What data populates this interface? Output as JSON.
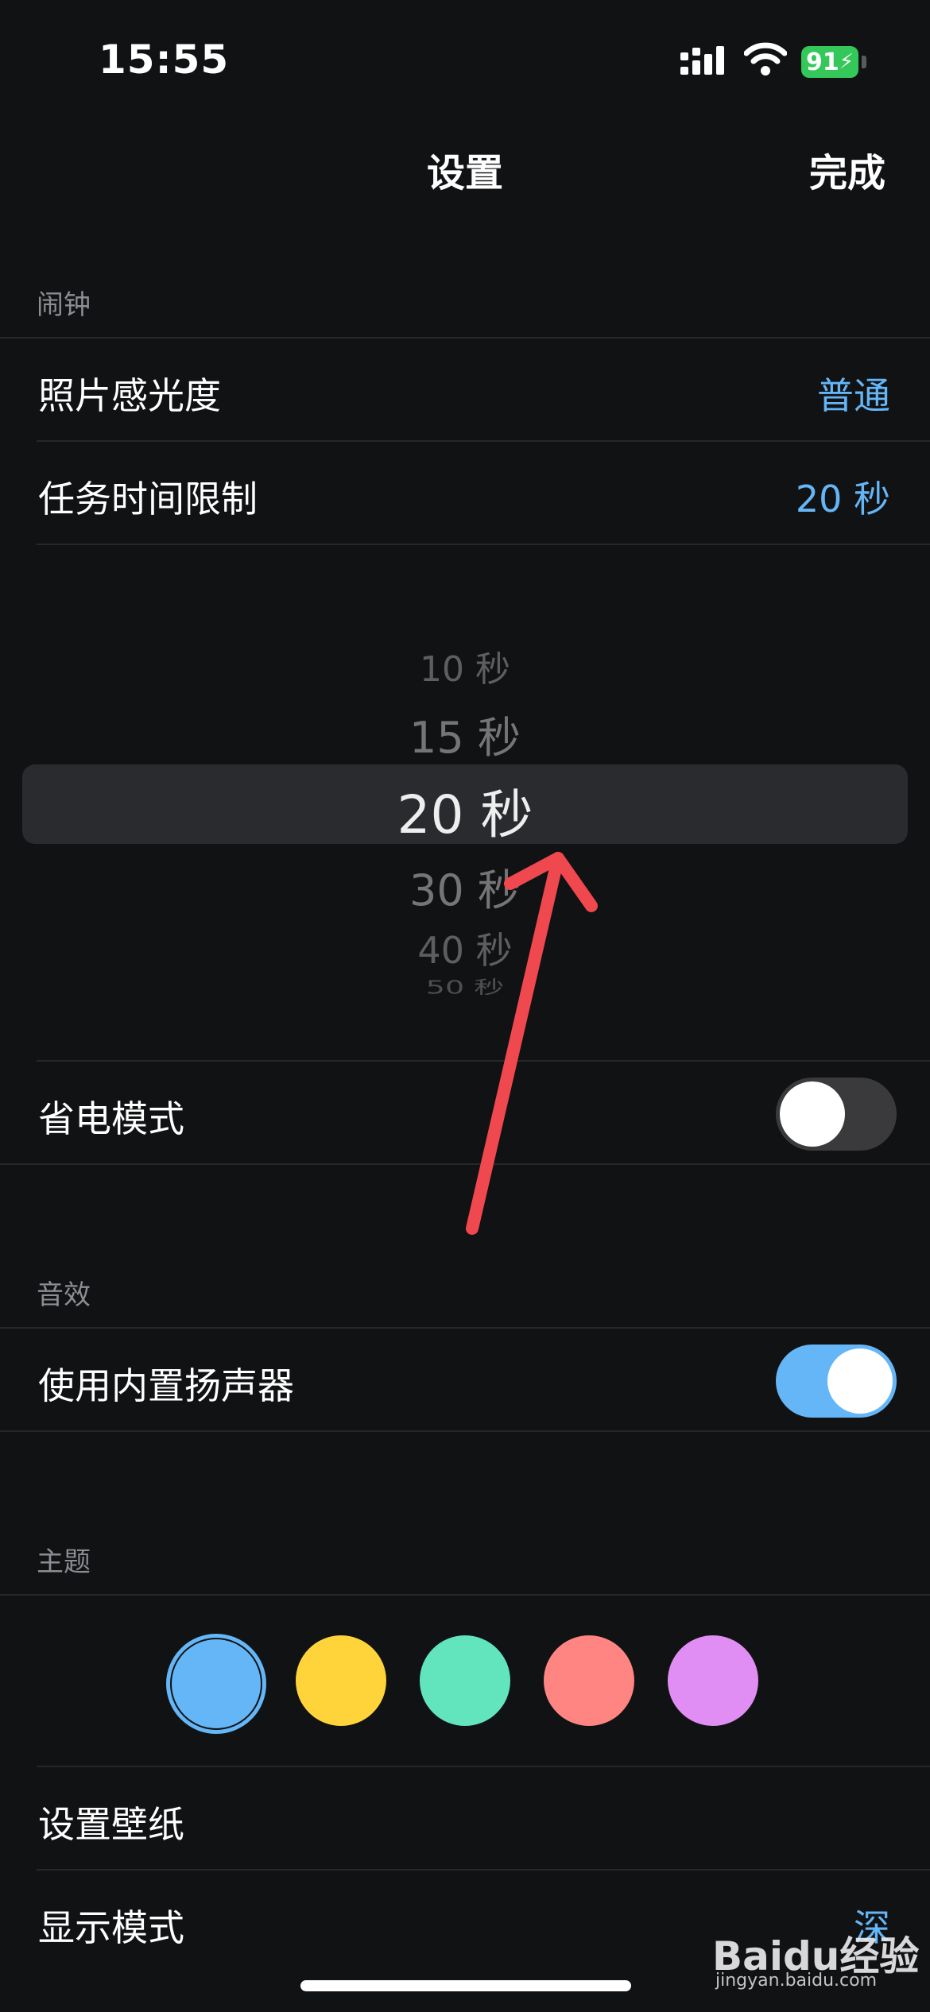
{
  "status_bar": {
    "time": "15:55",
    "battery_level": "91"
  },
  "nav": {
    "title": "设置",
    "done_label": "完成"
  },
  "sections": {
    "alarm": {
      "header": "闹钟",
      "photo_sensitivity": {
        "label": "照片感光度",
        "value": "普通"
      },
      "task_time_limit": {
        "label": "任务时间限制",
        "value": "20 秒"
      },
      "power_saving": {
        "label": "省电模式",
        "enabled": false
      }
    },
    "sound": {
      "header": "音效",
      "builtin_speaker": {
        "label": "使用内置扬声器",
        "enabled": true
      }
    },
    "theme": {
      "header": "主题",
      "colors": [
        "#64b6f7",
        "#ffd43a",
        "#62e4bd",
        "#ff8582",
        "#e08ef3"
      ],
      "selected_index": 0,
      "wallpaper_label": "设置壁纸",
      "display_mode": {
        "label": "显示模式",
        "value": "深"
      }
    }
  },
  "picker": {
    "options": [
      "10 秒",
      "15 秒",
      "20 秒",
      "30 秒",
      "40 秒",
      "50 秒"
    ],
    "selected": "20 秒"
  },
  "watermark": {
    "logo": "Baidu经验",
    "url": "jingyan.baidu.com"
  },
  "colors": {
    "background": "#111214",
    "accent": "#64b6f7",
    "toggle_off": "#3a3a3c",
    "annotation_arrow": "#f0484f"
  }
}
